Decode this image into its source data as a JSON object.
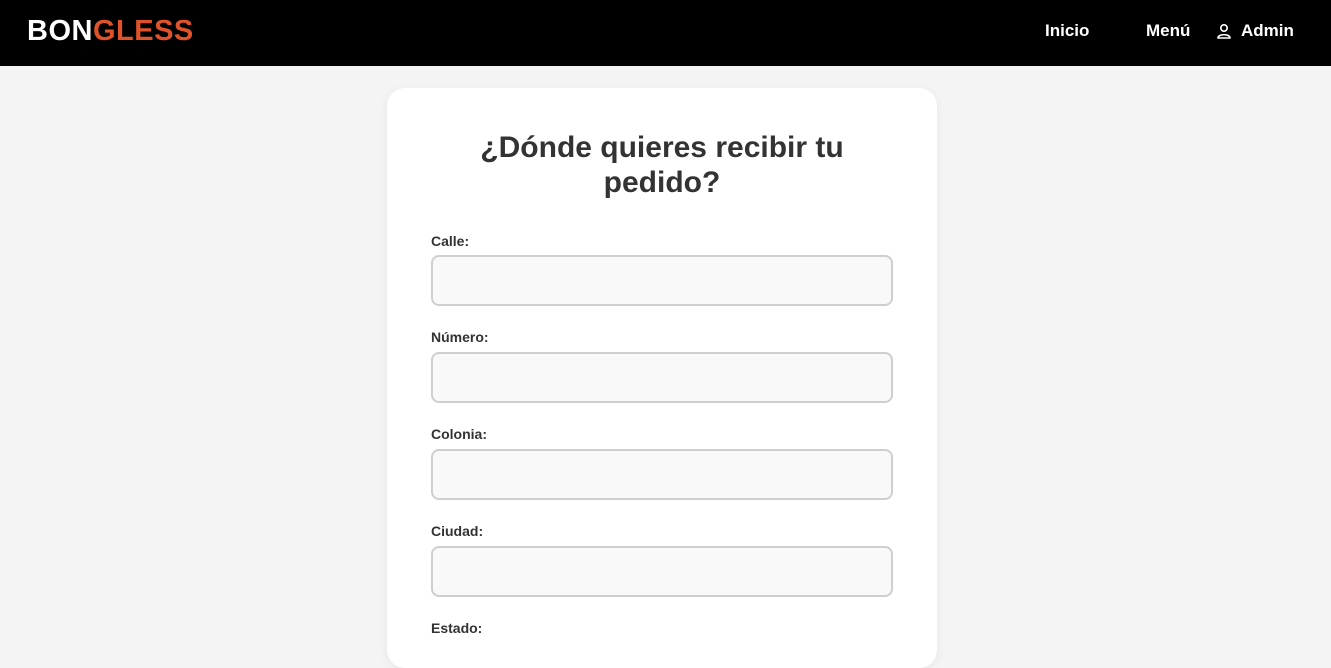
{
  "header": {
    "logo_part1": "BON",
    "logo_part2": "GLESS",
    "nav": {
      "inicio": "Inicio",
      "menu": "Menú",
      "admin": "Admin"
    },
    "admin_icon": "user-icon"
  },
  "form": {
    "title": "¿Dónde quieres recibir tu pedido?",
    "fields": [
      {
        "label": "Calle:",
        "value": ""
      },
      {
        "label": "Número:",
        "value": ""
      },
      {
        "label": "Colonia:",
        "value": ""
      },
      {
        "label": "Ciudad:",
        "value": ""
      },
      {
        "label": "Estado:",
        "value": ""
      }
    ]
  },
  "colors": {
    "topbar": "#000000",
    "brand_accent": "#e0522a",
    "background": "#f4f4f4"
  }
}
